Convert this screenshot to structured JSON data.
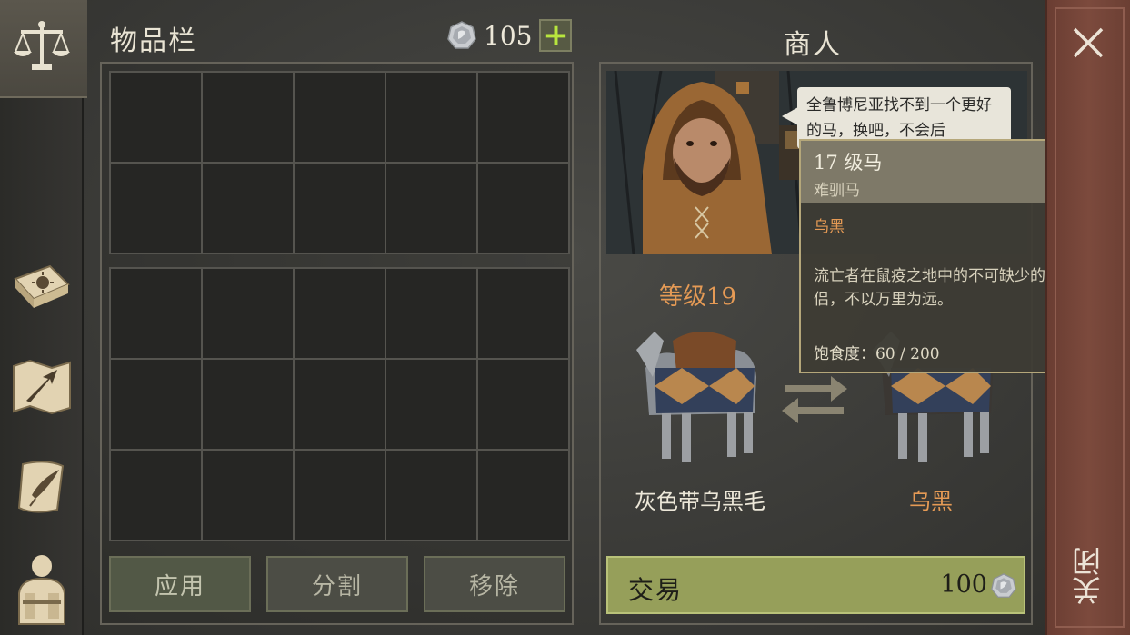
{
  "inventory": {
    "title": "物品栏",
    "currency_value": "105",
    "plus_label": "+",
    "buttons": {
      "apply": "应用",
      "split": "分割",
      "remove": "移除"
    }
  },
  "merchant": {
    "title": "商人",
    "speech": "全鲁博尼亚找不到一个更好的马，换吧，不会后",
    "left_level_label": "等级",
    "left_level_value": "19",
    "left_horse_name": "灰色带乌黑毛",
    "right_horse_name": "乌黑",
    "trade_label": "交易",
    "trade_price": "100"
  },
  "tooltip": {
    "level_value": "17",
    "level_text": " 级马",
    "subtitle": "难驯马",
    "color_name": "乌黑",
    "description": "流亡者在鼠疫之地中的不可缺少的伴侣，不以万里为远。",
    "stat_label": "饱食度：",
    "stat_value": "60 / 200"
  },
  "close": {
    "label": "关闭"
  },
  "sidebar": {
    "icons": [
      "scales-icon",
      "sun-book-icon",
      "map-arrow-icon",
      "scroll-quill-icon",
      "backpack-character-icon"
    ]
  },
  "colors": {
    "accent_orange": "#e59a55",
    "trade_green": "#969f5a",
    "plus_green": "#b8e63e",
    "close_panel": "#7c4a3d"
  }
}
